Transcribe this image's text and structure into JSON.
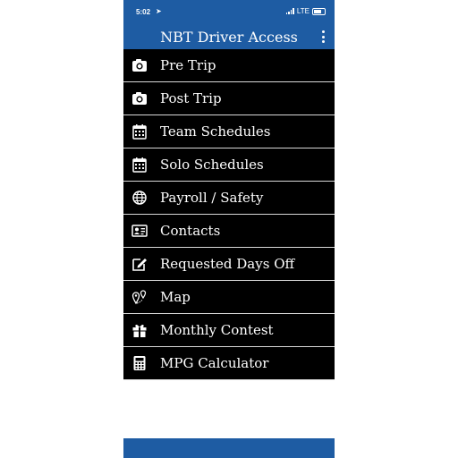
{
  "status_bar": {
    "time": "5:02",
    "network": "LTE"
  },
  "header": {
    "title": "NBT Driver Access",
    "menu_icon": "more-vertical-icon"
  },
  "colors": {
    "bar": "#1e5ca3",
    "list_bg": "#000000",
    "text": "#ffffff"
  },
  "menu": {
    "items": [
      {
        "label": "Pre Trip",
        "icon": "camera-icon"
      },
      {
        "label": "Post Trip",
        "icon": "camera-icon"
      },
      {
        "label": "Team Schedules",
        "icon": "calendar-icon"
      },
      {
        "label": "Solo Schedules",
        "icon": "calendar-icon"
      },
      {
        "label": "Payroll / Safety",
        "icon": "globe-icon"
      },
      {
        "label": "Contacts",
        "icon": "contact-card-icon"
      },
      {
        "label": "Requested Days Off",
        "icon": "edit-icon"
      },
      {
        "label": "Map",
        "icon": "map-pin-icon"
      },
      {
        "label": "Monthly Contest",
        "icon": "gift-icon"
      },
      {
        "label": "MPG Calculator",
        "icon": "calculator-icon"
      }
    ]
  }
}
